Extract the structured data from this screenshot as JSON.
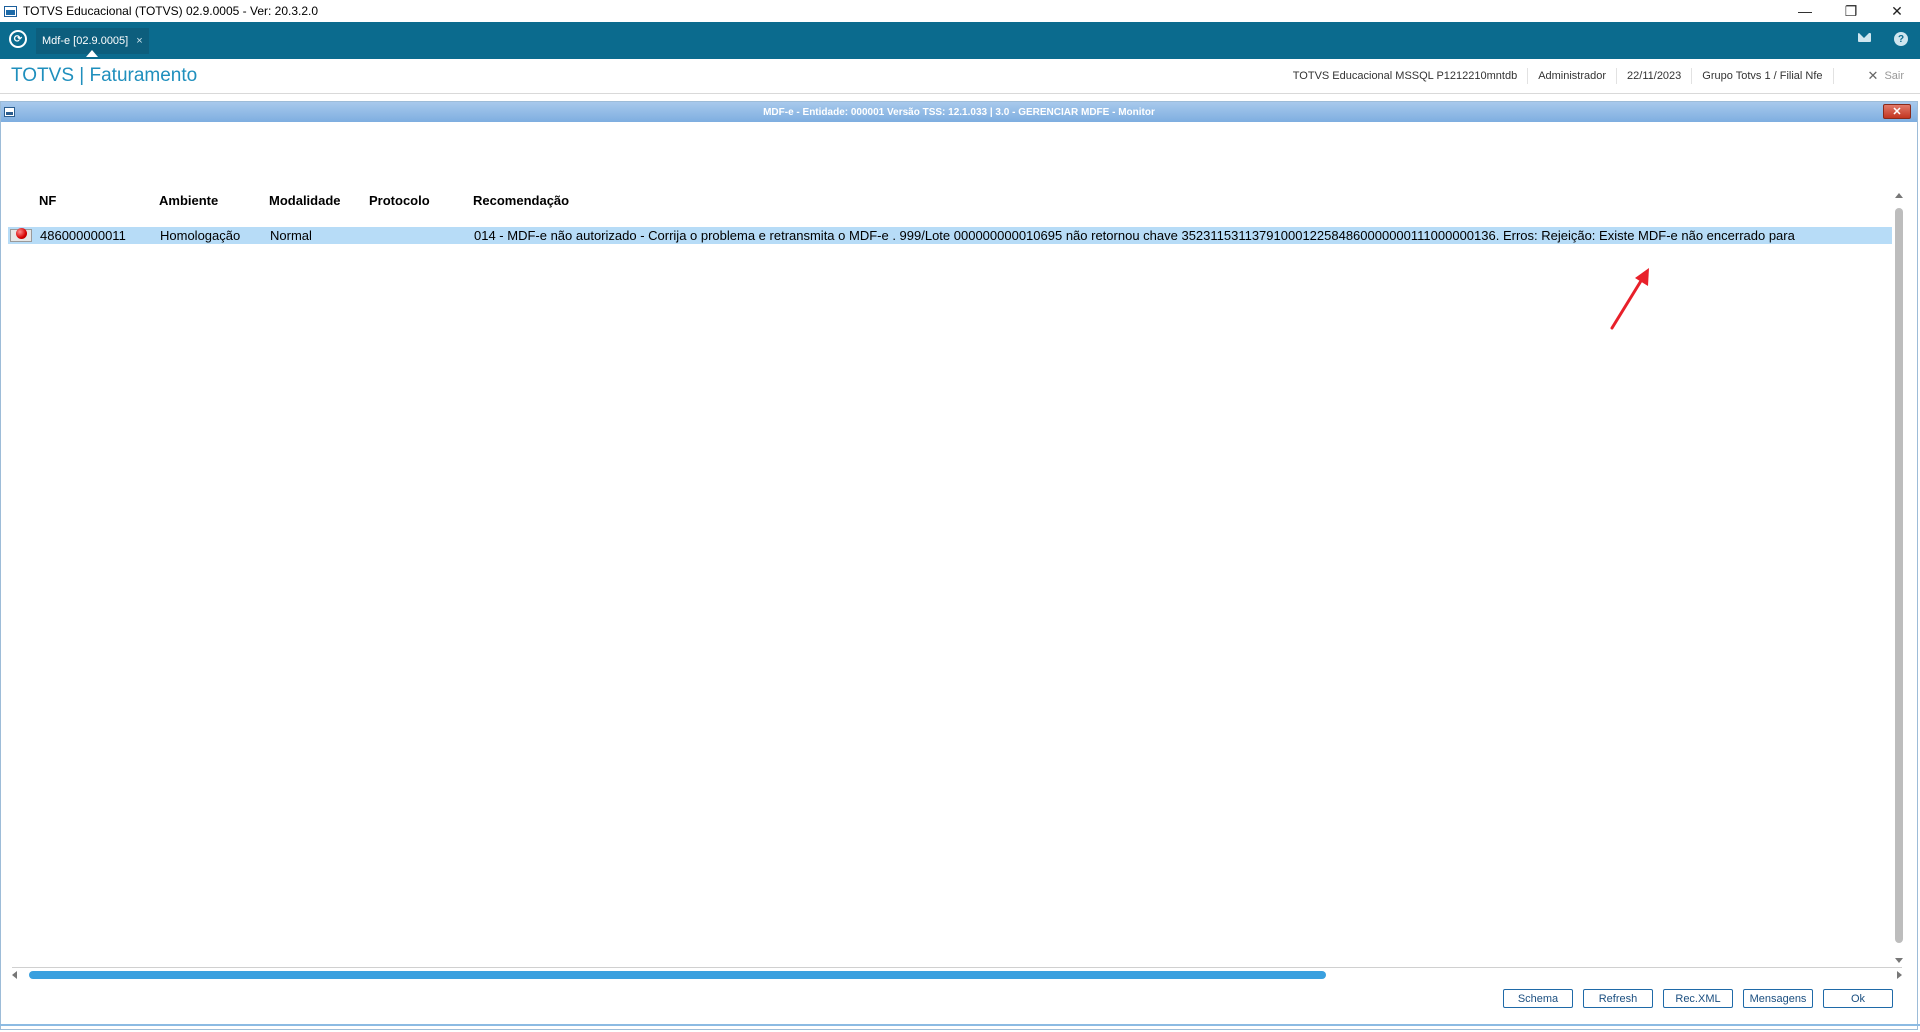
{
  "window": {
    "title": "TOTVS Educacional (TOTVS) 02.9.0005 - Ver: 20.3.2.0",
    "controls": {
      "minimize": "—",
      "restore": "❐",
      "close": "✕"
    }
  },
  "tabbar": {
    "home_icon": "⟳",
    "active_tab": {
      "label": "Mdf-e [02.9.0005]",
      "close": "×"
    },
    "help_icon": "?"
  },
  "header": {
    "title": "TOTVS | Faturamento",
    "info": {
      "database": "TOTVS Educacional MSSQL P1212210mntdb",
      "user": "Administrador",
      "date": "22/11/2023",
      "branch": "Grupo Totvs 1 / Filial Nfe"
    },
    "exit_label": "Sair",
    "exit_icon": "✕"
  },
  "dialog": {
    "title": "MDF-e - Entidade: 000001 Versão TSS: 12.1.033 | 3.0 - GERENCIAR MDFE - Monitor",
    "close_icon": "✕",
    "grid": {
      "columns": [
        "NF",
        "Ambiente",
        "Modalidade",
        "Protocolo",
        "Recomendação"
      ],
      "rows": [
        {
          "status": "error",
          "nf": "486000000011",
          "ambiente": "Homologação",
          "modalidade": "Normal",
          "protocolo": "",
          "recomendacao": "014 - MDF-e não autorizado - Corrija o problema e retransmita o MDF-e . 999/Lote 000000000010695 não retornou chave 35231153113791000122584860000000111000000136. Erros: Rejeição: Existe MDF-e não encerrado para"
        }
      ]
    },
    "buttons": {
      "schema": "Schema",
      "refresh": "Refresh",
      "rec_xml": "Rec.XML",
      "mensagens": "Mensagens",
      "ok": "Ok"
    }
  },
  "colors": {
    "tabbar": "#0b6b8e",
    "module_title": "#1f8fbd",
    "selected_row": "#b7dcf7",
    "scroll_thumb": "#3aa0df",
    "annotation_arrow": "#e8202a"
  }
}
